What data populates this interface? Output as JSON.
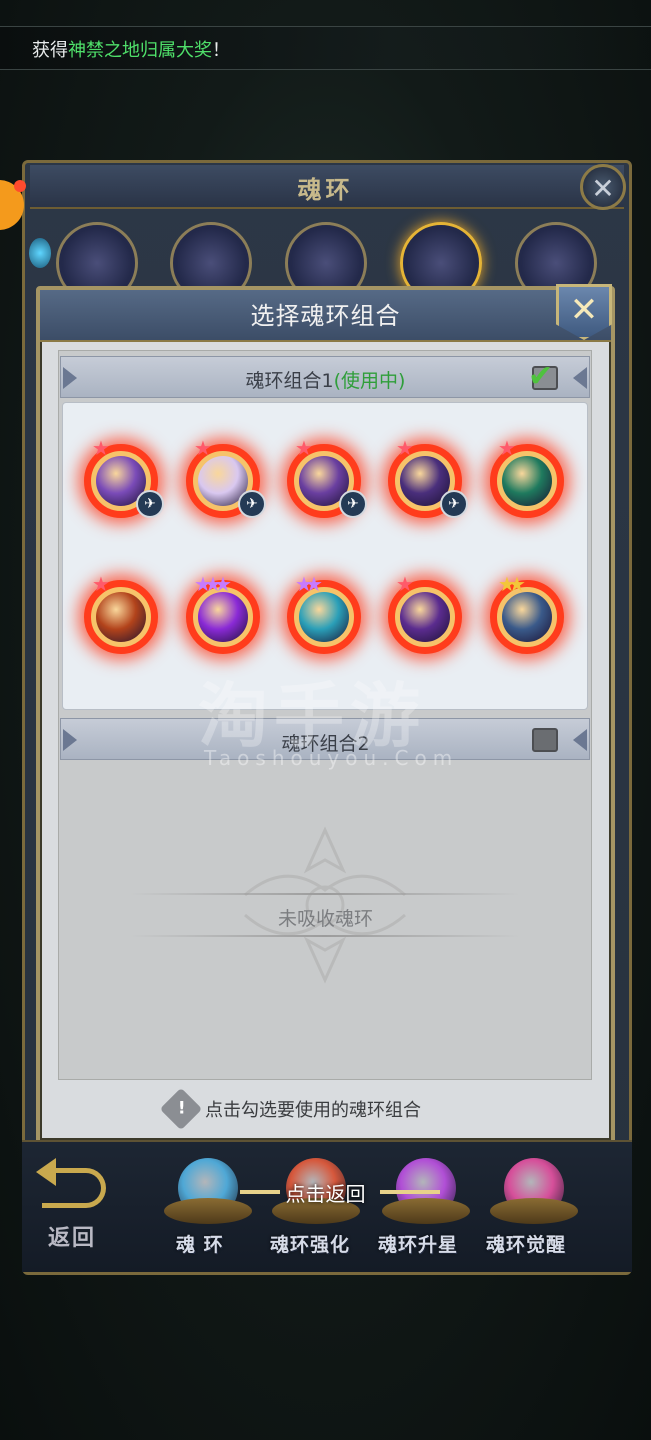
{
  "notice": {
    "prefix": "获得",
    "highlight": "神禁之地归属大奖",
    "suffix": "！"
  },
  "background_window": {
    "title": "魂环",
    "close_glyph": "✕"
  },
  "modal": {
    "title": "选择魂环组合",
    "close_glyph": "✕",
    "combo1": {
      "label_prefix": "魂环组合1",
      "status": "(使用中)",
      "checked": true
    },
    "combo2": {
      "label": "魂环组合2",
      "checked": false,
      "empty_text": "未吸收魂环"
    },
    "hint": "点击勾选要使用的魂环组合",
    "hint_icon_glyph": "!"
  },
  "soul_rings": [
    {
      "icon": "purple-claw-ring-icon",
      "stars": 1,
      "star_color": "#ff5a6a",
      "core_color": "#7a4bb8",
      "has_badge": true
    },
    {
      "icon": "white-orb-ring-icon",
      "stars": 1,
      "star_color": "#ff5a6a",
      "core_color": "#d9c8f0",
      "has_badge": true
    },
    {
      "icon": "purple-beast-ring-icon",
      "stars": 1,
      "star_color": "#ff5a6a",
      "core_color": "#6a3fa0",
      "has_badge": true
    },
    {
      "icon": "dark-wolf-ring-icon",
      "stars": 1,
      "star_color": "#ff5a6a",
      "core_color": "#4a2f7c",
      "has_badge": true
    },
    {
      "icon": "green-wing-ring-icon",
      "stars": 1,
      "star_color": "#ff5a6a",
      "core_color": "#1f7a5e",
      "has_badge": false
    },
    {
      "icon": "fire-beast-ring-icon",
      "stars": 1,
      "star_color": "#ff5a6a",
      "core_color": "#b2431b",
      "has_badge": false
    },
    {
      "icon": "violet-aura-ring-icon",
      "stars": 3,
      "star_color": "#c77bff",
      "core_color": "#8a2ad6",
      "has_badge": false
    },
    {
      "icon": "ice-spirit-ring-icon",
      "stars": 2,
      "star_color": "#c77bff",
      "core_color": "#2a9fb8",
      "has_badge": false
    },
    {
      "icon": "purple-skull-ring-icon",
      "stars": 1,
      "star_color": "#ff5a6a",
      "core_color": "#5b2c8f",
      "has_badge": false
    },
    {
      "icon": "frost-dragon-ring-icon",
      "stars": 2,
      "star_color": "#f3c63a",
      "core_color": "#3a5a8a",
      "has_badge": false
    }
  ],
  "badge_glyph": "✈",
  "bottom_nav": {
    "back_label": "返回",
    "tap_return": "点击返回",
    "tabs": [
      {
        "label": "魂 环",
        "orb_color": "#4fa8d6"
      },
      {
        "label": "魂环强化",
        "orb_color": "#d6583c"
      },
      {
        "label": "魂环升星",
        "orb_color": "#b14fd6"
      },
      {
        "label": "魂环觉醒",
        "orb_color": "#d64f9a"
      }
    ]
  },
  "watermark": {
    "main": "淘手游",
    "sub": "Taoshouyou.Com"
  }
}
